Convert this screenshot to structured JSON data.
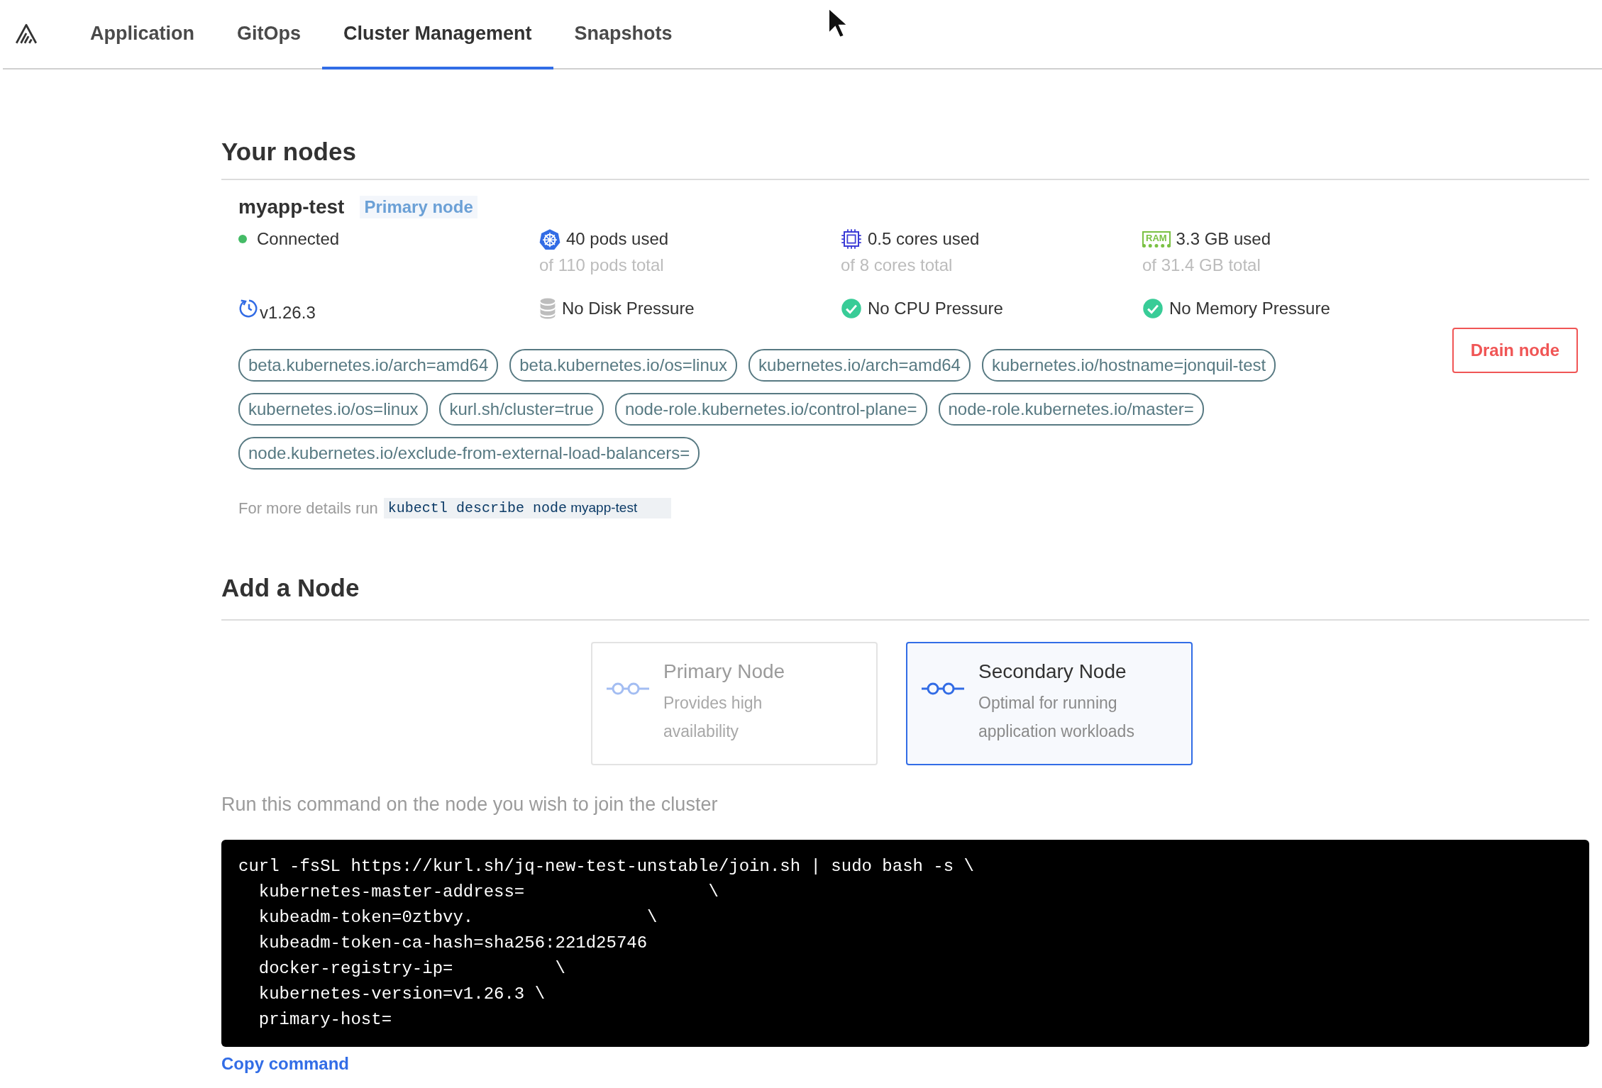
{
  "nav": {
    "tabs": [
      {
        "label": "Application",
        "selected": false
      },
      {
        "label": "GitOps",
        "selected": false
      },
      {
        "label": "Cluster Management",
        "selected": true
      },
      {
        "label": "Snapshots",
        "selected": false
      }
    ]
  },
  "nodes_section": {
    "title": "Your nodes",
    "node": {
      "name": "myapp-test",
      "badge": "Primary node",
      "status": "Connected",
      "connected": true,
      "stats": [
        {
          "kind": "pods",
          "value": "40 pods used",
          "total": "of 110 pods total"
        },
        {
          "kind": "cpu",
          "value": "0.5 cores used",
          "total": "of 8 cores total"
        },
        {
          "kind": "ram",
          "icon_text": "RAM",
          "value": "3.3 GB used",
          "total": "of 31.4 GB total"
        }
      ],
      "version": "v1.26.3",
      "conditions": [
        {
          "kind": "disk",
          "label": "No Disk Pressure"
        },
        {
          "kind": "check",
          "label": "No CPU Pressure"
        },
        {
          "kind": "check",
          "label": "No Memory Pressure"
        }
      ],
      "drain_button": "Drain node",
      "labels": [
        "beta.kubernetes.io/arch=amd64",
        "beta.kubernetes.io/os=linux",
        "kubernetes.io/arch=amd64",
        "kubernetes.io/hostname=jonquil-test",
        "kubernetes.io/os=linux",
        "kurl.sh/cluster=true",
        "node-role.kubernetes.io/control-plane=",
        "node-role.kubernetes.io/master=",
        "node.kubernetes.io/exclude-from-external-load-balancers="
      ],
      "details_hint": "For more details run",
      "details_command": "kubectl describe node",
      "details_node": "myapp-test"
    }
  },
  "add_section": {
    "title": "Add a Node",
    "options": [
      {
        "title": "Primary Node",
        "description": "Provides high availability",
        "selected": false
      },
      {
        "title": "Secondary Node",
        "description": "Optimal for running application workloads",
        "selected": true
      }
    ],
    "instruction": "Run this command on the node you wish to join the cluster",
    "command_lines": [
      "curl -fsSL https://kurl.sh/jq-new-test-unstable/join.sh | sudo bash -s \\",
      "  kubernetes-master-address=                  \\",
      "  kubeadm-token=0ztbvy.                 \\",
      "  kubeadm-token-ca-hash=sha256:221d25746",
      "  docker-registry-ip=          \\",
      "  kubernetes-version=v1.26.3 \\",
      "  primary-host="
    ],
    "copy_link": "Copy command"
  }
}
